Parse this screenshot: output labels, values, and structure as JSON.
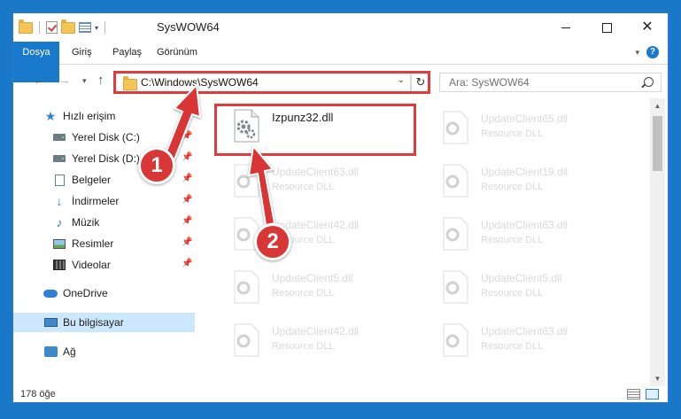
{
  "window": {
    "title": "SysWOW64",
    "controls": {
      "minimize": "minimize-icon",
      "maximize": "maximize-icon",
      "close": "✕"
    }
  },
  "ribbon": {
    "tabs": [
      {
        "label": "Dosya",
        "active": true
      },
      {
        "label": "Giriş"
      },
      {
        "label": "Paylaş"
      },
      {
        "label": "Görünüm"
      }
    ]
  },
  "nav": {
    "address": "C:\\Windows\\SysWOW64",
    "search_placeholder": "Ara: SysWOW64"
  },
  "sidebar": {
    "items": [
      {
        "label": "Hızlı erişim",
        "icon": "star-icon"
      },
      {
        "label": "Yerel Disk (C:)",
        "icon": "disk-icon",
        "pinned": true
      },
      {
        "label": "Yerel Disk (D:)",
        "icon": "disk-icon",
        "pinned": true
      },
      {
        "label": "Belgeler",
        "icon": "document-icon",
        "pinned": true
      },
      {
        "label": "İndirmeler",
        "icon": "download-icon",
        "pinned": true
      },
      {
        "label": "Müzik",
        "icon": "music-icon",
        "pinned": true
      },
      {
        "label": "Resimler",
        "icon": "pictures-icon",
        "pinned": true
      },
      {
        "label": "Videolar",
        "icon": "video-icon",
        "pinned": true
      },
      {
        "label": "OneDrive",
        "icon": "cloud-icon"
      },
      {
        "label": "Bu bilgisayar",
        "icon": "computer-icon",
        "selected": true
      },
      {
        "label": "Ağ",
        "icon": "network-icon"
      }
    ]
  },
  "files": [
    {
      "name": "Izpunz32.dll",
      "type": "",
      "highlight": true
    },
    {
      "name": "UpdateClient65.dll",
      "type": "Resource DLL"
    },
    {
      "name": "UpdateClient63.dll",
      "type": "Resource DLL"
    },
    {
      "name": "UpdateClient19.dll",
      "type": "Resource DLL"
    },
    {
      "name": "UpdateClient42.dll",
      "type": "Resource DLL"
    },
    {
      "name": "UpdateClient63.dll",
      "type": "Resource DLL"
    },
    {
      "name": "UpdateClient5.dll",
      "type": "Resource DLL"
    },
    {
      "name": "UpdateClient5.dll",
      "type": "Resource DLL"
    },
    {
      "name": "UpdateClient42.dll",
      "type": "Resource DLL"
    },
    {
      "name": "UpdateClient63.dll",
      "type": "Resource DLL"
    }
  ],
  "status": {
    "item_count": "178 öğe"
  },
  "annotations": {
    "step1": "1",
    "step2": "2",
    "color": "#d93636"
  }
}
